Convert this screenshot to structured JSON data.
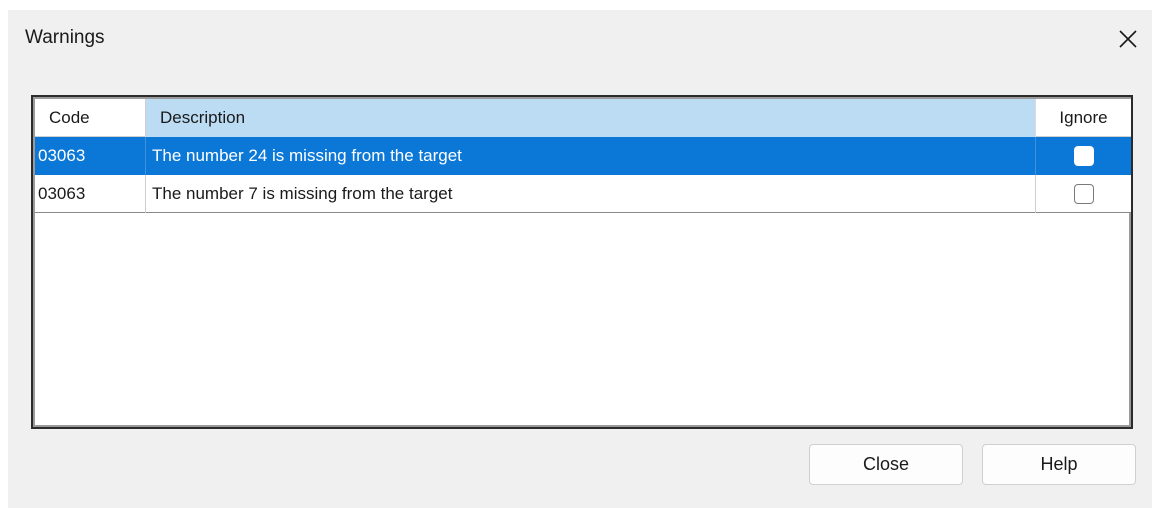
{
  "window": {
    "title": "Warnings",
    "close_icon": "close-icon"
  },
  "grid": {
    "columns": [
      "Code",
      "Description",
      "Ignore"
    ],
    "rows": [
      {
        "code": "03063",
        "description": "The number 24 is missing from the target",
        "ignore": false,
        "selected": true
      },
      {
        "code": "03063",
        "description": "The number 7 is missing from the target",
        "ignore": false,
        "selected": false
      }
    ]
  },
  "buttons": {
    "close_label": "Close",
    "help_label": "Help"
  },
  "colors": {
    "selection": "#0b78d7",
    "header_highlight": "#bcdcf3",
    "dialog_background": "#f0f0f0"
  }
}
